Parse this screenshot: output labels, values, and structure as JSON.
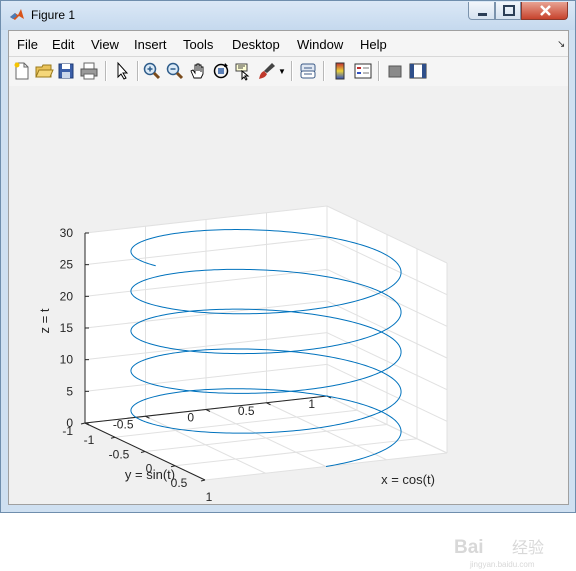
{
  "window": {
    "title": "Figure 1"
  },
  "menu": [
    {
      "key": "file",
      "label": "File"
    },
    {
      "key": "edit",
      "label": "Edit"
    },
    {
      "key": "view",
      "label": "View"
    },
    {
      "key": "insert",
      "label": "Insert"
    },
    {
      "key": "tools",
      "label": "Tools"
    },
    {
      "key": "desktop",
      "label": "Desktop"
    },
    {
      "key": "window",
      "label": "Window"
    },
    {
      "key": "help",
      "label": "Help"
    }
  ],
  "toolbar": [
    "new-figure-icon",
    "open-file-icon",
    "save-icon",
    "print-icon",
    "edit-plot-arrow-icon",
    "zoom-in-icon",
    "zoom-out-icon",
    "pan-hand-icon",
    "rotate-3d-icon",
    "data-cursor-icon",
    "brush-icon",
    "link-plot-icon",
    "colorbar-icon",
    "legend-icon",
    "hide-plot-tools-icon",
    "show-plot-tools-icon"
  ],
  "chart_data": {
    "type": "line",
    "projection": "3d",
    "series": [
      {
        "function": "x = cos(t), y = sin(t), z = t",
        "t_range": [
          0,
          30
        ],
        "color": "#0072bd"
      }
    ],
    "xlabel": "x = cos(t)",
    "ylabel": "y = sin(t)",
    "zlabel": "z = t",
    "xlim": [
      -1,
      1
    ],
    "ylim": [
      -1,
      1
    ],
    "zlim": [
      0,
      30
    ],
    "xticks": [
      "-1",
      "-0.5",
      "0",
      "0.5",
      "1"
    ],
    "yticks": [
      "-1",
      "-0.5",
      "0",
      "0.5",
      "1"
    ],
    "zticks": [
      "0",
      "5",
      "10",
      "15",
      "20",
      "25",
      "30"
    ],
    "grid": true,
    "box": false
  },
  "watermark": {
    "text": "Bai",
    "text2": "经验",
    "url": "jingyan.baidu.com"
  }
}
